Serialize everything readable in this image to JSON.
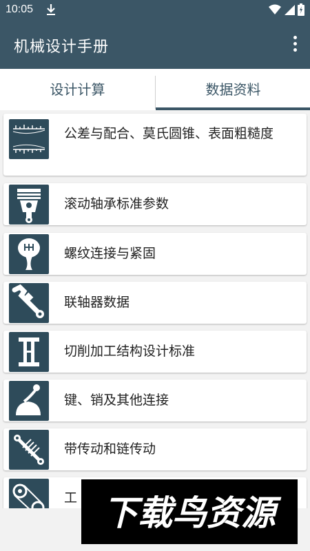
{
  "status_bar": {
    "time": "10:05"
  },
  "app_bar": {
    "title": "机械设计手册"
  },
  "tabs": [
    {
      "label": "设计计算",
      "selected": false
    },
    {
      "label": "数据资料",
      "selected": true
    }
  ],
  "items": [
    {
      "label": "公差与配合、莫氏圆锥、表面粗糙度",
      "icon": "ruler-chart-icon"
    },
    {
      "label": "滚动轴承标准参数",
      "icon": "piston-icon"
    },
    {
      "label": "螺纹连接与紧固",
      "icon": "gear-knob-icon"
    },
    {
      "label": "联轴器数据",
      "icon": "wrench-icon"
    },
    {
      "label": "切削加工结构设计标准",
      "icon": "i-beam-icon"
    },
    {
      "label": "键、销及其他连接",
      "icon": "lever-icon"
    },
    {
      "label": "带传动和链传动",
      "icon": "shock-absorber-icon"
    },
    {
      "label": "工",
      "icon": "chain-belt-icon"
    }
  ],
  "watermark": {
    "text": "下载鸟资源"
  },
  "colors": {
    "primary": "#3b5666",
    "icon_bg": "#2e4b5a",
    "background": "#f2f2f2"
  }
}
